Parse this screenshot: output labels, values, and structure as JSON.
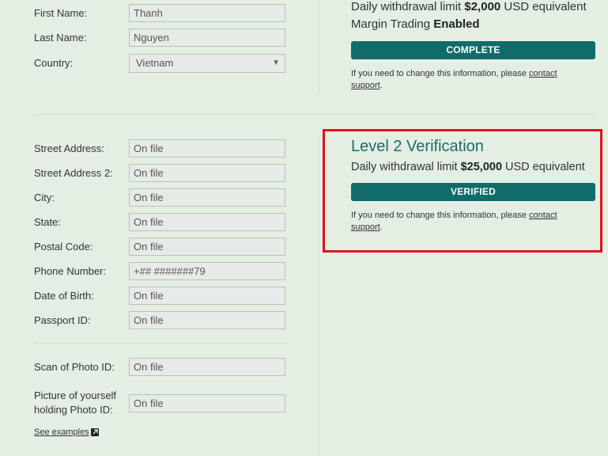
{
  "personal": {
    "first_name": {
      "label": "First Name:",
      "value": "Thanh"
    },
    "last_name": {
      "label": "Last Name:",
      "value": "Nguyen"
    },
    "country": {
      "label": "Country:",
      "value": "Vietnam"
    }
  },
  "level1": {
    "withdrawal_line_prefix": "Daily withdrawal limit ",
    "withdrawal_amount": "$2,000",
    "withdrawal_line_suffix": " USD equivalent",
    "margin_prefix": "Margin Trading ",
    "margin_status": "Enabled",
    "status_button": "COMPLETE",
    "note_prefix": "If you need to change this information, please ",
    "note_link_1": "contact",
    "note_link_2": "support",
    "note_suffix": "."
  },
  "level2": {
    "title": "Level 2 Verification",
    "withdrawal_line_prefix": "Daily withdrawal limit ",
    "withdrawal_amount": "$25,000",
    "withdrawal_line_suffix": " USD equivalent",
    "status_button": "VERIFIED",
    "note_prefix": "If you need to change this information, please ",
    "note_link_1": "contact",
    "note_link_2": "support",
    "note_suffix": "."
  },
  "address": {
    "street": {
      "label": "Street Address:",
      "value": "On file"
    },
    "street2": {
      "label": "Street Address 2:",
      "value": "On file"
    },
    "city": {
      "label": "City:",
      "value": "On file"
    },
    "state": {
      "label": "State:",
      "value": "On file"
    },
    "postal": {
      "label": "Postal Code:",
      "value": "On file"
    },
    "phone": {
      "label": "Phone Number:",
      "value": "+## #######79"
    },
    "dob": {
      "label": "Date of Birth:",
      "value": "On file"
    },
    "passport": {
      "label": "Passport ID:",
      "value": "On file"
    }
  },
  "documents": {
    "scan_photo_id": {
      "label": "Scan of Photo ID:",
      "value": "On file"
    },
    "picture_holding": {
      "label_line1": "Picture of yourself",
      "label_line2": "holding Photo ID:",
      "value": "On file"
    },
    "see_examples": "See examples"
  },
  "colors": {
    "background": "#e3efe3",
    "button": "#116b6b",
    "title": "#1d6b6b",
    "highlight": "#e3101b"
  },
  "icons": {
    "select_caret": "chevron-down-icon",
    "external_link": "external-link-icon"
  }
}
